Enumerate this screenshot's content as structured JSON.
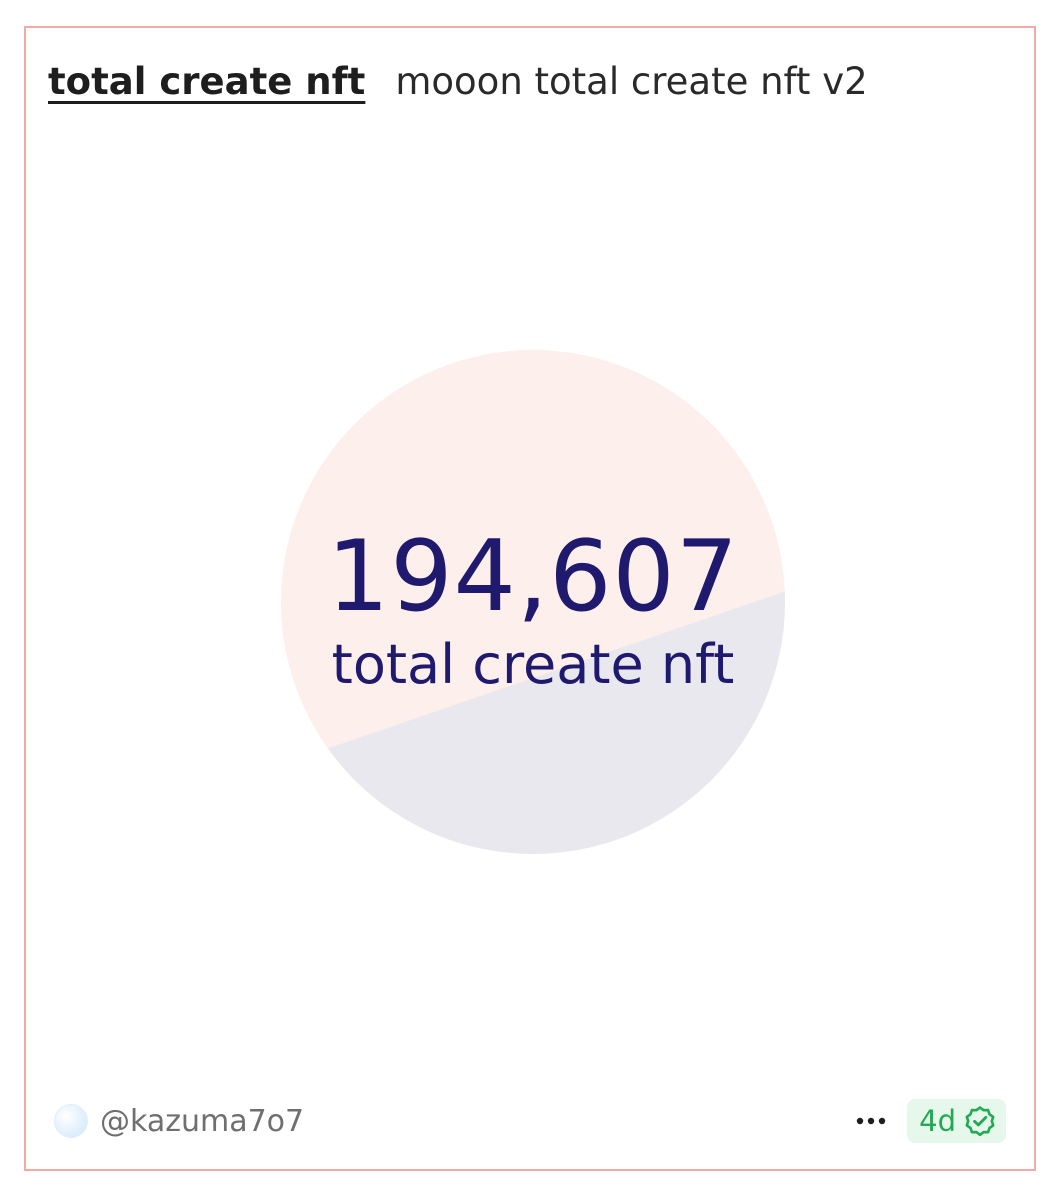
{
  "header": {
    "query_title": "total create nft",
    "viz_title": "mooon total create nft v2"
  },
  "counter": {
    "value": "194,607",
    "label": "total create nft"
  },
  "footer": {
    "author": "@kazuma7o7",
    "updated": "4d",
    "more_icon": "more-horizontal-icon",
    "verified_icon": "verified-check-icon"
  },
  "colors": {
    "border": "#f0aca4",
    "counter_text": "#1f1a6e",
    "circle_top": "#fcefec",
    "circle_bottom": "#e9e8ef",
    "badge_bg": "#e6f7ec",
    "badge_text": "#22a952"
  }
}
